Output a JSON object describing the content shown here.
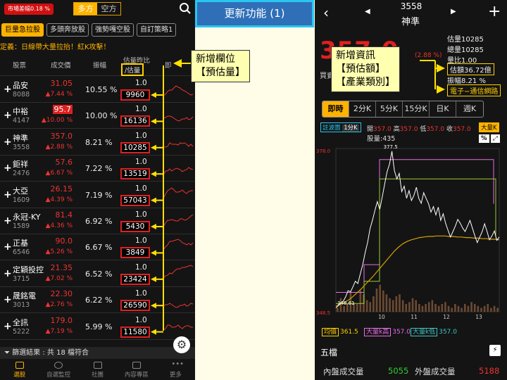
{
  "left_screen": {
    "market_badge": "市場差幅0.18 %",
    "direction_tabs": [
      "多方",
      "空方"
    ],
    "strategy_tabs": [
      "巨量急拉股",
      "多頭奔放股",
      "強勢嘎空股",
      "自訂策略1"
    ],
    "definition": "定義：日線帶大量拉抬！紅K攻擊！",
    "headers": {
      "stock": "股票",
      "price": "成交價",
      "amplitude": "振幅",
      "est_ratio": "估量昨比",
      "est_volume": "/估量",
      "chart": "即"
    },
    "rows": [
      {
        "name": "品安",
        "code": "8088",
        "price": "31.05",
        "change": "▲7.44 %",
        "amplitude": "10.55 %",
        "ratio": "1.0",
        "est": "9960",
        "highlight": false
      },
      {
        "name": "中裕",
        "code": "4147",
        "price": "95.7",
        "change": "▲10.00 %",
        "amplitude": "10.00 %",
        "ratio": "1.0",
        "est": "16136",
        "highlight": true
      },
      {
        "name": "神準",
        "code": "3558",
        "price": "357.0",
        "change": "▲2.88 %",
        "amplitude": "8.21 %",
        "ratio": "1.0",
        "est": "10285",
        "highlight": false
      },
      {
        "name": "鉅祥",
        "code": "2476",
        "price": "57.6",
        "change": "▲6.67 %",
        "amplitude": "7.22 %",
        "ratio": "1.0",
        "est": "13519",
        "highlight": false
      },
      {
        "name": "大亞",
        "code": "1609",
        "price": "26.15",
        "change": "▲4.39 %",
        "amplitude": "7.19 %",
        "ratio": "1.0",
        "est": "57043",
        "highlight": false
      },
      {
        "name": "永冠-KY",
        "code": "1589",
        "price": "81.4",
        "change": "▲4.36 %",
        "amplitude": "6.92 %",
        "ratio": "1.0",
        "est": "5430",
        "highlight": false
      },
      {
        "name": "正基",
        "code": "6546",
        "price": "90.0",
        "change": "▲5.26 %",
        "amplitude": "6.67 %",
        "ratio": "1.0",
        "est": "3849",
        "highlight": false
      },
      {
        "name": "定穎投控",
        "code": "3715",
        "price": "21.35",
        "change": "▲7.02 %",
        "amplitude": "6.52 %",
        "ratio": "1.0",
        "est": "23424",
        "highlight": false
      },
      {
        "name": "晟銘電",
        "code": "3013",
        "price": "22.30",
        "change": "▲2.76 %",
        "amplitude": "6.22 %",
        "ratio": "1.0",
        "est": "26590",
        "highlight": false
      },
      {
        "name": "全訊",
        "code": "5222",
        "price": "179.0",
        "change": "▲7.19 %",
        "amplitude": "5.99 %",
        "ratio": "1.0",
        "est": "11580",
        "highlight": false
      }
    ],
    "filter_result": "篩選結果 : 共 18 檔符合",
    "nav": [
      "選股",
      "自選監控",
      "社團",
      "內容專區",
      "更多"
    ]
  },
  "middle": {
    "header": "更新功能 (1)",
    "callout_left": [
      "新增欄位",
      "【預估量】"
    ],
    "callout_right": [
      "新增資訊",
      "【預估額】",
      "【產業類別】"
    ]
  },
  "right_screen": {
    "code": "3558",
    "name": "神準",
    "big_price": "357.0",
    "change_pct": "(2.88 %)",
    "buy_label": "買賣",
    "stats": [
      "估量10285",
      "總量10285",
      "量比1.00",
      "估額36.72億",
      "振幅8.21 %",
      "電子−通信網路"
    ],
    "period_tabs": [
      "即時",
      "2分K",
      "5分K",
      "15分K",
      "日K",
      "週K"
    ],
    "chart_label": "註波圖",
    "chart_interval": "1分K",
    "ohlc": {
      "open_label": "開",
      "open": "357.0",
      "high_label": "高",
      "high": "357.0",
      "low_label": "低",
      "low": "357.0",
      "close_label": "收",
      "close": "357.0"
    },
    "volume": "股量:435",
    "bigk_btn": "大量K",
    "pct_btn": "%",
    "expand_btn": "⤢",
    "footer_chips": [
      {
        "label": "均價",
        "value": "361.5"
      },
      {
        "label": "大量k高",
        "value": "357.0"
      },
      {
        "label": "大量k低",
        "value": "357.0"
      }
    ],
    "five_label": "五檔",
    "inner_label": "內盤成交量",
    "inner_value": "5055",
    "outer_label": "外盤成交量",
    "outer_value": "5188"
  },
  "chart_data": {
    "type": "line",
    "y_top_label": "378.0",
    "y_bottom_label": "348.5",
    "peak_label": "377.5",
    "low_label": "348.61",
    "xticks": [
      "10",
      "11",
      "12",
      "13"
    ],
    "ylim": [
      348.5,
      378.0
    ],
    "price": [
      349.2,
      349.6,
      350.1,
      350.4,
      351.2,
      352.3,
      352.1,
      353.0,
      354.0,
      353.6,
      355.3,
      357.0,
      359.2,
      361.0,
      363.5,
      365.0,
      366.8,
      368.4,
      367.0,
      369.2,
      371.6,
      373.8,
      375.2,
      377.5,
      374.0,
      372.5,
      373.5,
      370.2,
      371.2,
      369.0,
      370.4,
      368.6,
      369.5,
      371.0,
      369.0,
      368.1,
      370.0,
      369.0,
      368.0,
      366.5,
      367.5,
      366.0,
      367.4,
      365.0,
      366.2,
      364.5,
      363.2,
      362.0,
      363.0,
      364.0,
      365.2,
      364.5,
      363.6,
      363.0,
      364.0,
      365.0,
      363.6,
      362.2,
      361.0,
      362.0,
      363.0,
      364.4,
      363.0,
      361.5,
      362.2,
      363.1,
      361.4,
      362.0
    ],
    "avg": [
      349.5,
      349.8,
      350.2,
      350.6,
      351.2,
      351.9,
      352.6,
      353.4,
      354.2,
      355.0,
      355.9,
      356.8,
      357.7,
      358.6,
      359.5,
      360.2,
      360.8,
      361.2,
      361.5,
      361.7,
      361.9,
      362.0,
      362.1,
      362.1,
      362.2,
      362.2,
      362.2,
      362.1,
      362.1,
      362.0,
      362.0,
      361.9,
      361.9,
      361.8,
      361.8,
      361.7,
      361.7,
      361.6,
      361.6,
      361.5
    ],
    "big_k_high": 357.0,
    "big_k_low": 357.0,
    "volume_bars": [
      0.1,
      0.35,
      0.15,
      0.2,
      0.5,
      0.25,
      0.2,
      0.55,
      0.45,
      0.3,
      0.25,
      0.4,
      0.6,
      0.7,
      0.55,
      0.45,
      0.35,
      0.3,
      0.4,
      0.45,
      0.3,
      0.2,
      0.25,
      0.35,
      0.3,
      0.2,
      0.15,
      0.2,
      0.25,
      0.3,
      0.2,
      0.15,
      0.2,
      0.25,
      0.15,
      0.1,
      0.2,
      0.15,
      0.1,
      0.2,
      0.15,
      0.25,
      0.2,
      0.15,
      0.1,
      0.15,
      0.2,
      0.1,
      0.15,
      0.1
    ]
  }
}
